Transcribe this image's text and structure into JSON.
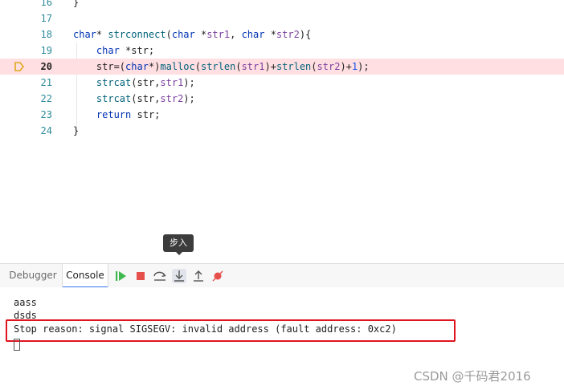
{
  "editor": {
    "lines": [
      {
        "num": "16",
        "code": "}"
      },
      {
        "num": "17",
        "code": ""
      },
      {
        "num": "18",
        "code": "char* strconnect(char *str1, char *str2){"
      },
      {
        "num": "19",
        "code": "    char *str;"
      },
      {
        "num": "20",
        "code": "    str=(char*)malloc(strlen(str1)+strlen(str2)+1);"
      },
      {
        "num": "21",
        "code": "    strcat(str,str1);"
      },
      {
        "num": "22",
        "code": "    strcat(str,str2);"
      },
      {
        "num": "23",
        "code": "    return str;"
      },
      {
        "num": "24",
        "code": "}"
      }
    ],
    "current_line": "20",
    "highlight_color": "#ffdfe2"
  },
  "tooltip": {
    "text": "步入"
  },
  "debug_panel": {
    "tabs": [
      {
        "label": "Debugger",
        "active": false
      },
      {
        "label": "Console",
        "active": true
      }
    ],
    "buttons": [
      {
        "icon": "resume-icon",
        "color": "#3fb850"
      },
      {
        "icon": "stop-icon",
        "color": "#e5504d"
      },
      {
        "icon": "step-over-icon"
      },
      {
        "icon": "step-into-icon",
        "pressed": true
      },
      {
        "icon": "step-out-icon"
      },
      {
        "icon": "mute-breakpoints-icon",
        "color": "#e5504d"
      }
    ]
  },
  "console": {
    "lines": [
      "aass",
      "dsds",
      "Stop reason: signal SIGSEGV: invalid address (fault address: 0xc2)"
    ],
    "highlight_border_color": "#e0141e"
  },
  "watermark": "CSDN @千码君2016"
}
